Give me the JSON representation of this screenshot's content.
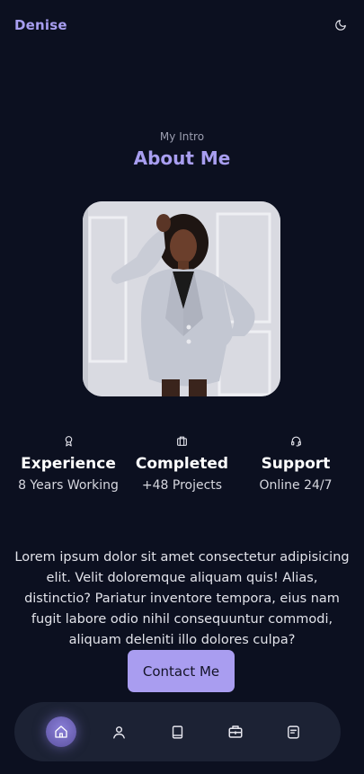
{
  "header": {
    "logo": "Denise",
    "theme_toggle_icon": "moon-icon"
  },
  "about": {
    "subtitle": "My Intro",
    "title": "About Me",
    "photo_icon": "portrait-photo"
  },
  "stats": [
    {
      "icon": "award-icon",
      "title": "Experience",
      "subtitle": "8 Years Working"
    },
    {
      "icon": "briefcase-icon",
      "title": "Completed",
      "subtitle": "+48 Projects"
    },
    {
      "icon": "headset-icon",
      "title": "Support",
      "subtitle": "Online 24/7"
    }
  ],
  "description": "Lorem ipsum dolor sit amet consectetur adipisicing elit. Velit doloremque aliquam quis! Alias, distinctio? Pariatur inventore tempora, eius nam fugit labore odio nihil consequuntur commodi, aliquam deleniti illo dolores culpa?",
  "contact_label": "Contact Me",
  "nav": {
    "items": [
      {
        "icon": "home-icon",
        "active": true
      },
      {
        "icon": "user-icon",
        "active": false
      },
      {
        "icon": "book-icon",
        "active": false
      },
      {
        "icon": "briefcase-icon",
        "active": false
      },
      {
        "icon": "message-icon",
        "active": false
      }
    ]
  },
  "colors": {
    "background": "#0c1020",
    "accent": "#a89ef0",
    "button": "#a99df0",
    "nav_background": "#1c2234"
  }
}
